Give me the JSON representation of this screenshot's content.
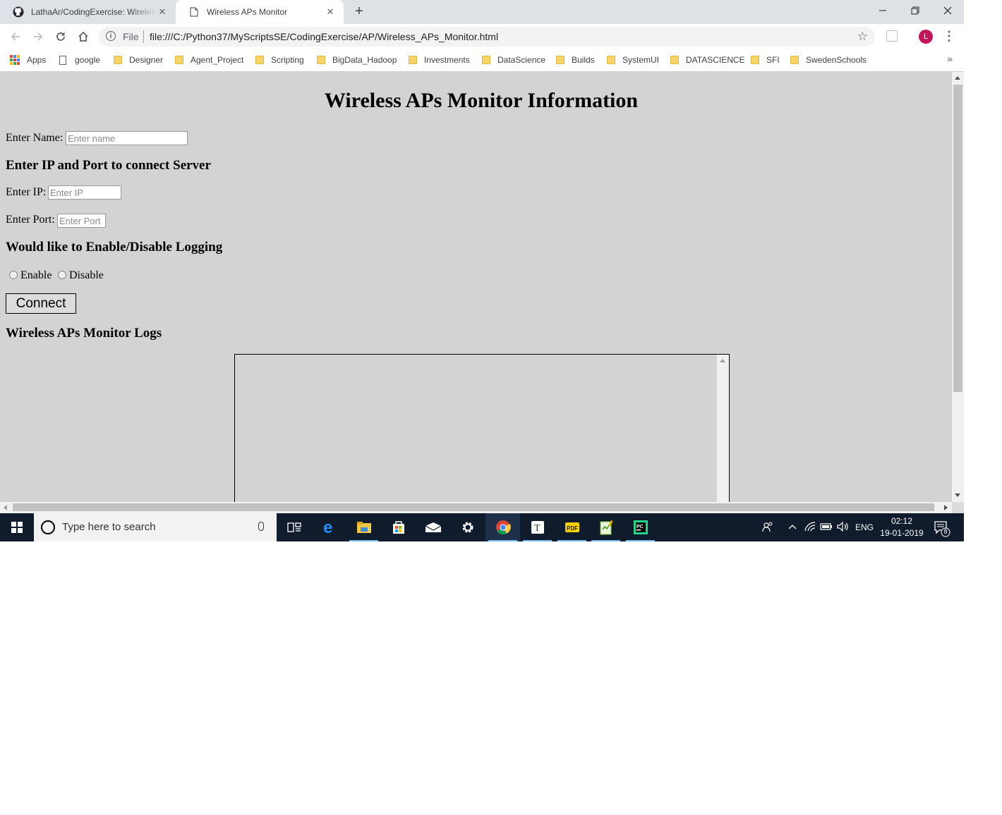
{
  "browser": {
    "tabs": [
      {
        "title": "LathaAr/CodingExercise: Wireless APs Monitor",
        "icon": "github-icon"
      },
      {
        "title": "Wireless APs Monitor",
        "icon": "page-icon"
      }
    ],
    "address_scheme": "File",
    "url": "file:///C:/Python37/MyScriptsSE/CodingExercise/AP/Wireless_APs_Monitor.html",
    "profile_initial": "L",
    "bookmarks": [
      "Apps",
      "google",
      "Designer",
      "Agent_Project",
      "Scripting",
      "BigData_Hadoop",
      "Investments",
      "DataScience",
      "Builds",
      "SystemUI",
      "DATASCIENCE",
      "SFI",
      "SwedenSchools"
    ],
    "bookmarks_overflow": "»"
  },
  "page": {
    "title": "Wireless APs Monitor Information",
    "name_label": "Enter Name:",
    "name_placeholder": "Enter name",
    "server_heading": "Enter IP and Port to connect Server",
    "ip_label": "Enter IP:",
    "ip_placeholder": "Enter IP",
    "port_label": "Enter Port:",
    "port_placeholder": "Enter Port",
    "logging_heading": "Would like to Enable/Disable Logging",
    "enable_label": "Enable",
    "disable_label": "Disable",
    "connect_label": "Connect",
    "logs_heading": "Wireless APs Monitor Logs",
    "logs_text": ""
  },
  "taskbar": {
    "search_placeholder": "Type here to search",
    "apps": [
      "task-view",
      "edge",
      "file-explorer",
      "store",
      "mail",
      "settings",
      "chrome",
      "typora",
      "pdf-reader",
      "notepad-plus",
      "pycharm"
    ],
    "language": "ENG",
    "time": "02:12",
    "date": "19-01-2019",
    "notification_count": "8"
  },
  "colors": {
    "page_background": "#d3d3d3",
    "taskbar": "#101b2b",
    "accent_underline": "#76b9ed",
    "avatar": "#c2185b"
  }
}
